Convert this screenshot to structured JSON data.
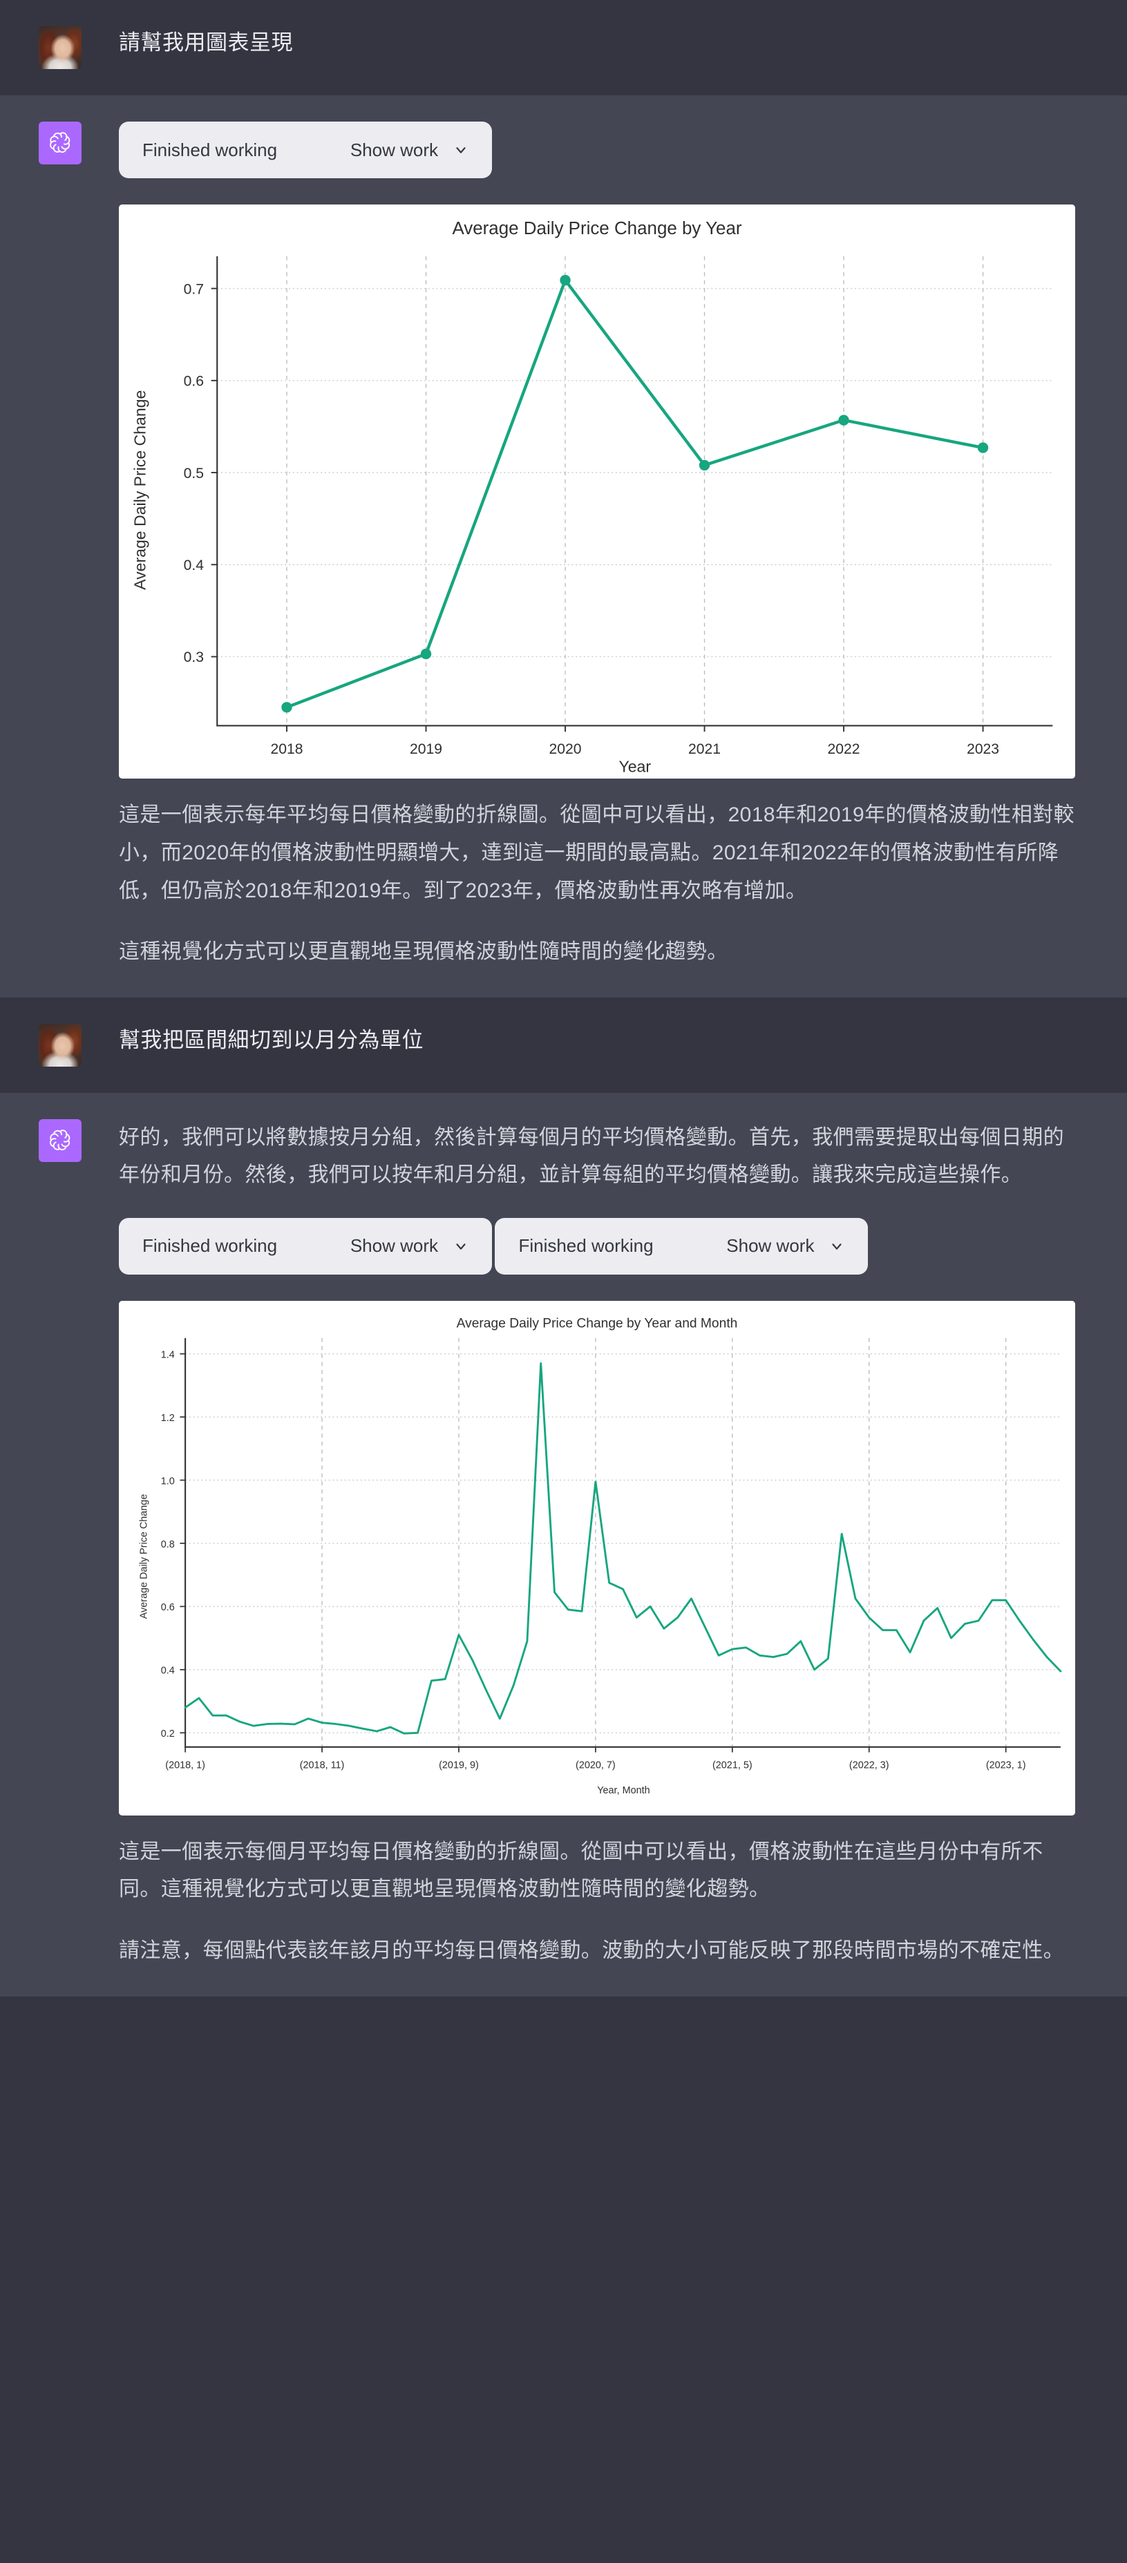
{
  "theme": {
    "user_bg": "#343541",
    "assistant_bg": "#444654",
    "accent_purple": "#ab68ff",
    "line_color": "#17a67f",
    "chart_bg": "#ffffff"
  },
  "turns": [
    {
      "role": "user",
      "avatar_name": "user-avatar-photo",
      "text": "請幫我用圖表呈現"
    },
    {
      "role": "assistant",
      "avatar_name": "chatgpt-logo-icon",
      "tool_cards": [
        {
          "status": "Finished working",
          "action": "Show work"
        }
      ],
      "paragraphs": [
        "這是一個表示每年平均每日價格變動的折線圖。從圖中可以看出，2018年和2019年的價格波動性相對較小，而2020年的價格波動性明顯增大，達到這一期間的最高點。2021年和2022年的價格波動性有所降低，但仍高於2018年和2019年。到了2023年，價格波動性再次略有增加。",
        "這種視覺化方式可以更直觀地呈現價格波動性隨時間的變化趨勢。"
      ]
    },
    {
      "role": "user",
      "avatar_name": "user-avatar-photo",
      "text": "幫我把區間細切到以月分為單位"
    },
    {
      "role": "assistant",
      "avatar_name": "chatgpt-logo-icon",
      "intro": "好的，我們可以將數據按月分組，然後計算每個月的平均價格變動。首先，我們需要提取出每個日期的年份和月份。然後，我們可以按年和月分組，並計算每組的平均價格變動。讓我來完成這些操作。",
      "tool_cards": [
        {
          "status": "Finished working",
          "action": "Show work"
        },
        {
          "status": "Finished working",
          "action": "Show work"
        }
      ],
      "paragraphs": [
        "這是一個表示每個月平均每日價格變動的折線圖。從圖中可以看出，價格波動性在這些月份中有所不同。這種視覺化方式可以更直觀地呈現價格波動性隨時間的變化趨勢。",
        "請注意，每個點代表該年該月的平均每日價格變動。波動的大小可能反映了那段時間市場的不確定性。"
      ]
    }
  ],
  "chart_data": [
    {
      "type": "line",
      "title": "Average Daily Price Change by Year",
      "xlabel": "Year",
      "ylabel": "Average Daily Price Change",
      "categories": [
        "2018",
        "2019",
        "2020",
        "2021",
        "2022",
        "2023"
      ],
      "values": [
        0.245,
        0.303,
        0.709,
        0.508,
        0.557,
        0.527
      ],
      "xticks": [
        "2018",
        "2019",
        "2020",
        "2021",
        "2022",
        "2023"
      ],
      "yticks": [
        0.3,
        0.4,
        0.5,
        0.6,
        0.7
      ],
      "ylim": [
        0.225,
        0.735
      ],
      "grid": true,
      "legend": "none",
      "markers": true,
      "line_color": "#17a67f"
    },
    {
      "type": "line",
      "title": "Average Daily Price Change by Year and Month",
      "xlabel": "Year, Month",
      "ylabel": "Average Daily Price Change",
      "xticks": [
        "(2018, 1)",
        "(2018, 11)",
        "(2019, 9)",
        "(2020, 7)",
        "(2021, 5)",
        "(2022, 3)",
        "(2023, 1)"
      ],
      "xtick_indices": [
        0,
        10,
        20,
        30,
        40,
        50,
        60
      ],
      "yticks": [
        0.2,
        0.4,
        0.6,
        0.8,
        1.0,
        1.2,
        1.4
      ],
      "ylim": [
        0.155,
        1.45
      ],
      "grid": true,
      "legend": "none",
      "markers": false,
      "line_color": "#17a67f",
      "x": [
        "(2018, 1)",
        "(2018, 2)",
        "(2018, 3)",
        "(2018, 4)",
        "(2018, 5)",
        "(2018, 6)",
        "(2018, 7)",
        "(2018, 8)",
        "(2018, 9)",
        "(2018, 10)",
        "(2018, 11)",
        "(2018, 12)",
        "(2019, 1)",
        "(2019, 2)",
        "(2019, 3)",
        "(2019, 4)",
        "(2019, 5)",
        "(2019, 6)",
        "(2019, 7)",
        "(2019, 8)",
        "(2019, 9)",
        "(2019, 10)",
        "(2019, 11)",
        "(2019, 12)",
        "(2020, 1)",
        "(2020, 2)",
        "(2020, 3)",
        "(2020, 4)",
        "(2020, 5)",
        "(2020, 6)",
        "(2020, 7)",
        "(2020, 8)",
        "(2020, 9)",
        "(2020, 10)",
        "(2020, 11)",
        "(2020, 12)",
        "(2021, 1)",
        "(2021, 2)",
        "(2021, 3)",
        "(2021, 4)",
        "(2021, 5)",
        "(2021, 6)",
        "(2021, 7)",
        "(2021, 8)",
        "(2021, 9)",
        "(2021, 10)",
        "(2021, 11)",
        "(2021, 12)",
        "(2022, 1)",
        "(2022, 2)",
        "(2022, 3)",
        "(2022, 4)",
        "(2022, 5)",
        "(2022, 6)",
        "(2022, 7)",
        "(2022, 8)",
        "(2022, 9)",
        "(2022, 10)",
        "(2022, 11)",
        "(2022, 12)",
        "(2023, 1)",
        "(2023, 2)",
        "(2023, 3)",
        "(2023, 4)",
        "(2023, 5)"
      ],
      "values": [
        0.28,
        0.31,
        0.255,
        0.255,
        0.235,
        0.222,
        0.228,
        0.229,
        0.227,
        0.245,
        0.232,
        0.228,
        0.222,
        0.213,
        0.205,
        0.218,
        0.198,
        0.2,
        0.365,
        0.37,
        0.51,
        0.43,
        0.335,
        0.245,
        0.35,
        0.49,
        1.37,
        0.645,
        0.59,
        0.585,
        0.995,
        0.675,
        0.655,
        0.565,
        0.6,
        0.53,
        0.565,
        0.625,
        0.535,
        0.445,
        0.465,
        0.47,
        0.445,
        0.44,
        0.45,
        0.49,
        0.4,
        0.435,
        0.83,
        0.625,
        0.565,
        0.525,
        0.525,
        0.455,
        0.555,
        0.595,
        0.5,
        0.545,
        0.555,
        0.62,
        0.62,
        0.555,
        0.495,
        0.44,
        0.395
      ]
    }
  ]
}
